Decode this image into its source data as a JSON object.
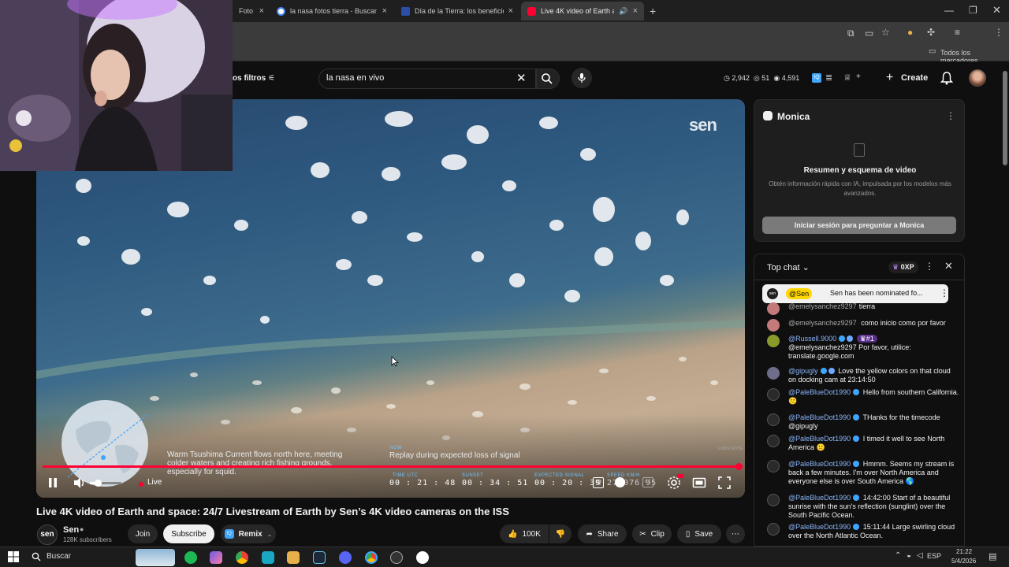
{
  "browser": {
    "tabs": [
      {
        "label": "Foto",
        "active": false
      },
      {
        "label": "la nasa fotos tierra - Buscar con",
        "active": false
      },
      {
        "label": "Día de la Tierra: los beneficios d",
        "active": false
      },
      {
        "label": "Live 4K video of Earth and s",
        "active": true
      }
    ],
    "new_tab": "+",
    "bookmarks_all": "Todos los marcadores"
  },
  "youtube": {
    "filters_label": "os filtros",
    "search_value": "la nasa en vivo",
    "stats": {
      "a": "2,942",
      "b": "51",
      "c": "4,591"
    },
    "create_label": "Create"
  },
  "video": {
    "watermark": "sen",
    "overlay_text_1": "Warm Tsushima Current flows north here, meeting",
    "overlay_text_2": "colder waters and creating rich fishing grounds,",
    "overlay_text_3": "especially for squid.",
    "now_label": "NOW",
    "now_text": "Replay during expected loss of signal",
    "subscribe_mark": "SUBSCRIBE",
    "time_utc_label": "TIME UTC",
    "time_utc": "00 : 21 : 48",
    "sunset_label": "SUNSET",
    "sunset": "00 : 34 : 51",
    "expected_label": "EXPECTED SIGNAL",
    "expected": "00 : 20 : 39",
    "speed_label": "SPEED KM/H",
    "speed": "27 076.95",
    "live_label": "Live",
    "iq_label": "IQ"
  },
  "title": "Live 4K video of Earth and space: 24/7 Livestream of Earth by Sen’s 4K video cameras on the ISS",
  "channel": {
    "name": "Sen",
    "subscribers": "128K subscribers",
    "join": "Join",
    "subscribe": "Subscribe",
    "remix": "Remix"
  },
  "actions": {
    "likes": "100K",
    "share": "Share",
    "clip": "Clip",
    "save": "Save"
  },
  "monica": {
    "name": "Monica",
    "heading": "Resumen y esquema de video",
    "desc_1": "Obtén información rápida con IA, impulsada por los modelos más",
    "desc_2": "avanzados.",
    "button": "Iniciar sesión para preguntar a Monica"
  },
  "chat": {
    "header": "Top chat",
    "xp": "0XP",
    "pinned_author": "@Sen",
    "pinned_text": "Sen has been nominated fo...",
    "messages": [
      {
        "author": "@emelysanchez9297",
        "text": "tierra",
        "color": "#c47a7a"
      },
      {
        "author": "@emelysanchez9297",
        "text": "como inicio como por favor",
        "color": "#c47a7a"
      },
      {
        "author": "@Russell.9000",
        "rank": "#1",
        "text": "@emelysanchez9297 Por favor, utilice: translate.google.com",
        "color": "#8a9a2a"
      },
      {
        "author": "@gipugly",
        "text": "Love the yellow colors on that cloud on docking cam at 23:14:50",
        "color": "#6e6e8a"
      },
      {
        "author": "@PaleBlueDot1990",
        "text": "Hello from southern California. 🙂",
        "color": "#2a2a2a"
      },
      {
        "author": "@PaleBlueDot1990",
        "text": "THanks for the timecode @gipugly",
        "color": "#2a2a2a"
      },
      {
        "author": "@PaleBlueDot1990",
        "text": "I timed it well to see North America 🙂",
        "color": "#2a2a2a"
      },
      {
        "author": "@PaleBlueDot1990",
        "text": "Hmmm. Seems my stream is back a few minutes. I'm over North America and everyone else is over South America 🌎",
        "color": "#2a2a2a"
      },
      {
        "author": "@PaleBlueDot1990",
        "text": "14:42:00 Start of a beautiful sunrise with the sun's reflection (sunglint) over the South Pacific Ocean.",
        "color": "#2a2a2a"
      },
      {
        "author": "@PaleBlueDot1990",
        "text": "15:11:44 Large swirling cloud over the North Atlantic Ocean.",
        "color": "#2a2a2a"
      }
    ]
  },
  "taskbar": {
    "search": "Buscar",
    "lang": "ESP",
    "time": "21:22",
    "date": "5/4/2026"
  }
}
